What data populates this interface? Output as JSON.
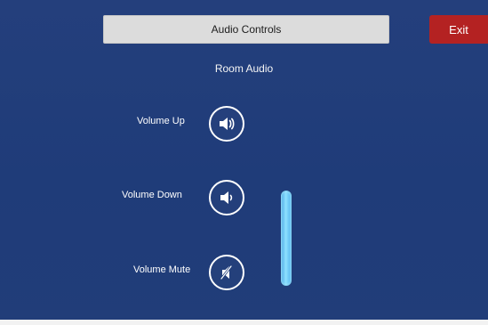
{
  "header": {
    "title": "Audio Controls",
    "exit_label": "Exit"
  },
  "section": {
    "title": "Room Audio"
  },
  "controls": [
    {
      "label": "Volume Up",
      "icon": "volume-up-icon"
    },
    {
      "label": "Volume Down",
      "icon": "volume-down-icon"
    },
    {
      "label": "Volume Mute",
      "icon": "volume-mute-icon"
    }
  ],
  "volume_level": {
    "value_percent": 100
  },
  "colors": {
    "background": "#22407c",
    "title_bar": "#dcdcdc",
    "exit": "#b42222",
    "slider": "#6ccaf4"
  }
}
